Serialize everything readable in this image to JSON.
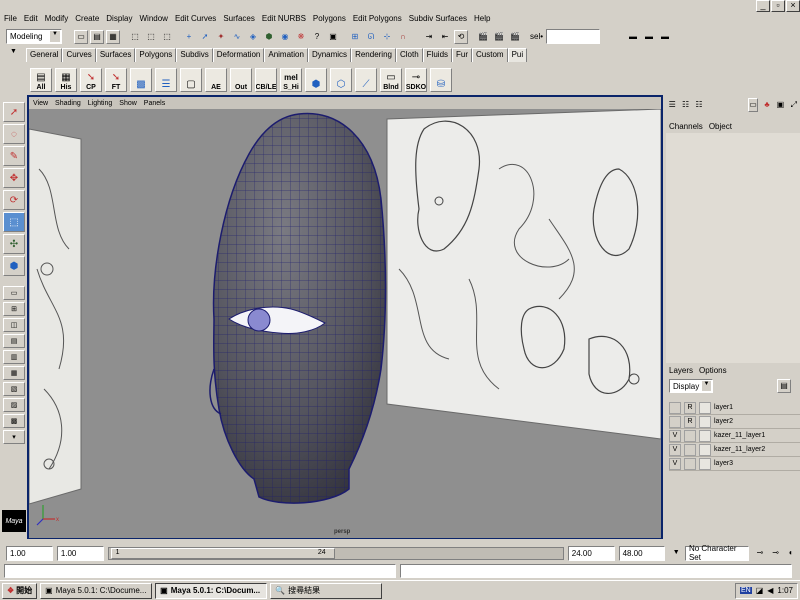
{
  "menubar": {
    "items": [
      "File",
      "Edit",
      "Modify",
      "Create",
      "Display",
      "Window",
      "Edit Curves",
      "Surfaces",
      "Edit NURBS",
      "Polygons",
      "Edit Polygons",
      "Subdiv Surfaces",
      "Help"
    ]
  },
  "statusline": {
    "mode": "Modeling",
    "sel_label": "sel•"
  },
  "shelf": {
    "tabs": [
      "General",
      "Curves",
      "Surfaces",
      "Polygons",
      "Subdivs",
      "Deformation",
      "Animation",
      "Dynamics",
      "Rendering",
      "Cloth",
      "Fluids",
      "Fur",
      "Custom",
      "Pui"
    ],
    "active_tab": "Pui",
    "buttons": [
      "All",
      "His",
      "CP",
      "FT",
      "",
      "",
      "",
      "AE",
      "Out",
      "CB/LE",
      "S_Hi",
      "",
      "",
      "",
      "Blnd",
      "SDKO",
      ""
    ],
    "mel_label": "mel"
  },
  "viewport": {
    "menu": [
      "View",
      "Shading",
      "Lighting",
      "Show",
      "Panels"
    ],
    "camera": "persp"
  },
  "channelbox": {
    "menu": [
      "Channels",
      "Object"
    ]
  },
  "layers": {
    "menu": [
      "Layers",
      "Options"
    ],
    "display_label": "Display",
    "rows": [
      {
        "v": "",
        "r": "R",
        "name": "layer1"
      },
      {
        "v": "",
        "r": "R",
        "name": "layer2"
      },
      {
        "v": "V",
        "r": "",
        "name": "kazer_11_layer1"
      },
      {
        "v": "V",
        "r": "",
        "name": "kazer_11_layer2"
      },
      {
        "v": "V",
        "r": "",
        "name": "layer3"
      }
    ]
  },
  "timeline": {
    "start": "1.00",
    "range_start": "1.00",
    "slider_start": "1",
    "slider_mid": "24",
    "range_end": "24.00",
    "end": "48.00",
    "character_set": "No Character Set"
  },
  "taskbar": {
    "start": "開始",
    "items": [
      "Maya 5.0.1: C:\\Docume...",
      "Maya 5.0.1: C:\\Docum...",
      "搜尋結果"
    ],
    "lang": "EN",
    "time": "1:07"
  },
  "colors": {
    "viewport_border": "#0a246a",
    "viewport_bg": "#8f8f8f",
    "mesh": "#5a5a64",
    "wire": "#1c1c6e",
    "selected_tool": "#5a8fd0"
  }
}
